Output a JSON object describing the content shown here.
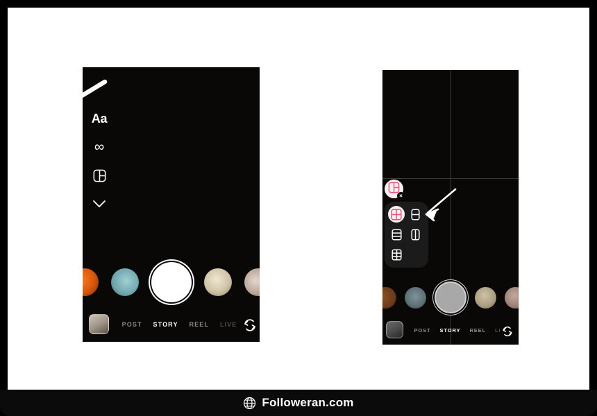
{
  "watermark": {
    "icon": "globe-icon",
    "text": "Followeran.com"
  },
  "left_phone": {
    "label": "instagram-story-camera-before",
    "tool_rail": [
      {
        "name": "text-tool",
        "label": "Aa",
        "icon": "text-aa-icon"
      },
      {
        "name": "boomerang-tool",
        "label": "∞",
        "icon": "infinity-icon"
      },
      {
        "name": "layout-tool",
        "label": "",
        "icon": "layout-grid-icon"
      },
      {
        "name": "more-tools",
        "label": "",
        "icon": "chevron-down-icon"
      }
    ],
    "annotation": {
      "name": "pointer-arrow",
      "direction": "down-left"
    },
    "thumbnails": [
      {
        "name": "story-thumb-1",
        "color": "#d8570f"
      },
      {
        "name": "story-thumb-2",
        "color": "#7fb3b8"
      },
      {
        "name": "shutter-button",
        "color": "#ffffff"
      },
      {
        "name": "story-thumb-3",
        "color": "#cfc4a8"
      },
      {
        "name": "story-thumb-4",
        "color": "#b9a598"
      }
    ],
    "gallery": {
      "name": "gallery-thumbnail",
      "color": "#9b9083"
    },
    "modes": [
      {
        "label": "POST",
        "active": false,
        "clipped": false
      },
      {
        "label": "STORY",
        "active": true,
        "clipped": false
      },
      {
        "label": "REEL",
        "active": false,
        "clipped": false
      },
      {
        "label": "LIVE",
        "active": false,
        "clipped": true
      }
    ],
    "flip_camera": {
      "name": "flip-camera-icon"
    }
  },
  "right_phone": {
    "label": "instagram-story-camera-layout-picker-open",
    "grid_overlay": {
      "columns": 2,
      "rows": 2,
      "line_color": "#3a3a3a"
    },
    "layout_toggle": {
      "name": "layout-toggle-button",
      "icon": "layout-grid-icon",
      "badge": "×",
      "accent": "#e8547f"
    },
    "layout_options": [
      {
        "name": "layout-option-2x2-grid",
        "icon": "grid-2x2-icon",
        "selected": true
      },
      {
        "name": "layout-option-2-rows",
        "icon": "rows-2-icon",
        "selected": false
      },
      {
        "name": "layout-option-3-rows",
        "icon": "rows-3-icon",
        "selected": false
      },
      {
        "name": "layout-option-2-columns",
        "icon": "columns-2-icon",
        "selected": false
      },
      {
        "name": "layout-option-3x2-grid",
        "icon": "grid-3x2-icon",
        "selected": false
      }
    ],
    "annotation": {
      "name": "pointer-arrow",
      "direction": "down-left"
    },
    "thumbnails": [
      {
        "name": "story-thumb-1",
        "color": "#6b3c1c"
      },
      {
        "name": "story-thumb-2",
        "color": "#5c7075"
      },
      {
        "name": "shutter-button",
        "color": "#a8a8a8"
      },
      {
        "name": "story-thumb-3",
        "color": "#a89c82"
      },
      {
        "name": "story-thumb-4",
        "color": "#9c8276"
      }
    ],
    "gallery": {
      "name": "gallery-thumbnail",
      "color": "#4a4a4a"
    },
    "modes": [
      {
        "label": "POST",
        "active": false,
        "clipped": false
      },
      {
        "label": "STORY",
        "active": true,
        "clipped": false
      },
      {
        "label": "REEL",
        "active": false,
        "clipped": false
      },
      {
        "label": "LI",
        "active": false,
        "clipped": true
      }
    ],
    "flip_camera": {
      "name": "flip-camera-icon"
    }
  },
  "colors": {
    "frame": "#000000",
    "canvas": "#ffffff",
    "phone_bg": "#0a0707",
    "accent_pink": "#e8547f",
    "panel_bg": "#1b1b1b",
    "selected_chip": "#fdf0ee",
    "mode_inactive": "#8b8b8b",
    "mode_active": "#ffffff"
  }
}
